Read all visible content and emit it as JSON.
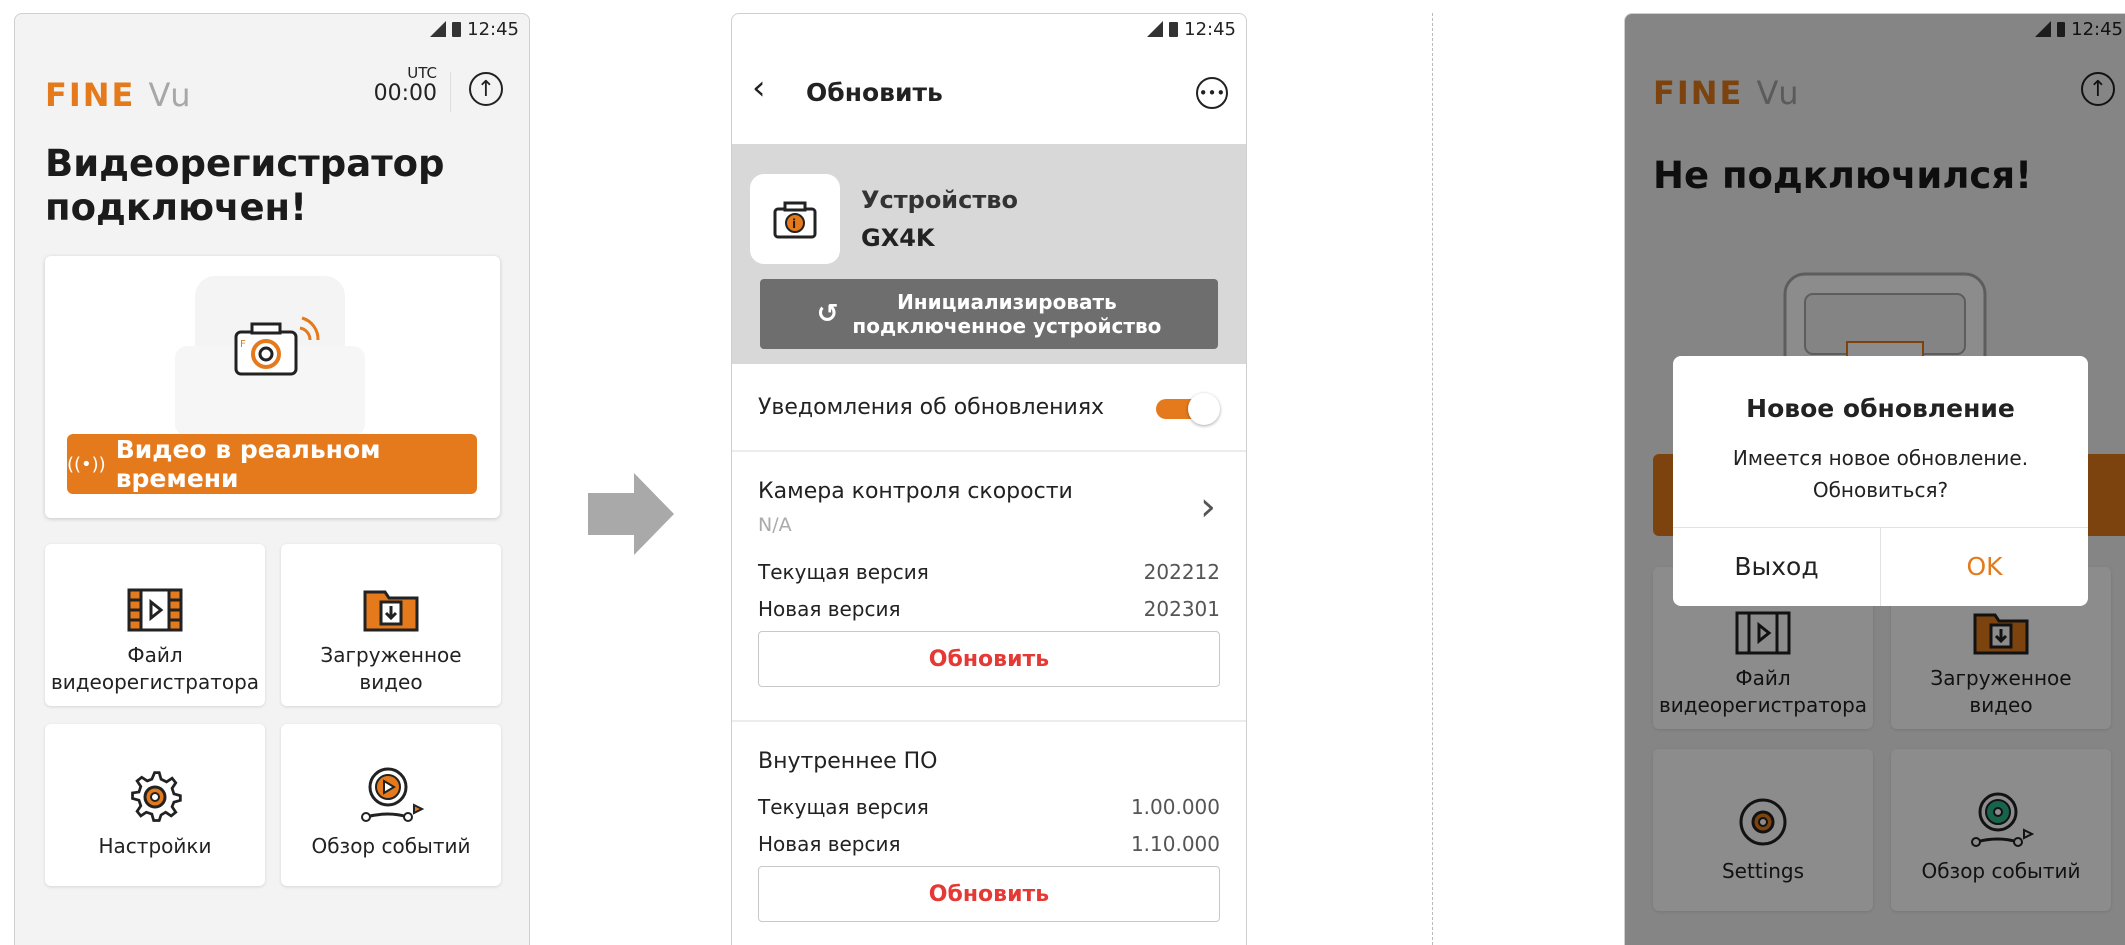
{
  "status_bar": {
    "time": "12:45"
  },
  "screen1": {
    "logo_fine": "FINE",
    "logo_vu": "Vu",
    "utc_label": "UTC",
    "utc_time": "00:00",
    "headline_line1": "Видеорегистратор",
    "headline_line2": "подключен!",
    "live_button": "Видео в реальном времени",
    "tiles": [
      {
        "label1": "Файл",
        "label2": "видеорегистратора"
      },
      {
        "label1": "Загруженное",
        "label2": "видео"
      },
      {
        "label1": "Настройки",
        "label2": ""
      },
      {
        "label1": "Обзор событий",
        "label2": ""
      }
    ]
  },
  "screen2": {
    "title": "Обновить",
    "device_label": "Устройство",
    "device_model": "GX4K",
    "init_button_line1": "Инициализировать",
    "init_button_line2": "подключенное устройство",
    "notifications_label": "Уведомления об обновлениях",
    "notifications_on": true,
    "speedcam": {
      "title": "Камера контроля скорости",
      "subtitle": "N/A",
      "current_label": "Текущая версия",
      "current_value": "202212",
      "new_label": "Новая версия",
      "new_value": "202301",
      "button": "Обновить"
    },
    "firmware": {
      "title": "Внутреннее ПО",
      "current_label": "Текущая версия",
      "current_value": "1.00.000",
      "new_label": "Новая версия",
      "new_value": "1.10.000",
      "button": "Обновить"
    }
  },
  "screen3": {
    "status_time": "12:45",
    "headline": "Не подключился!",
    "tiles": [
      {
        "label1": "Файл",
        "label2": "видеорегистратора"
      },
      {
        "label1": "Загруженное",
        "label2": "видео"
      },
      {
        "label1": "Settings",
        "label2": ""
      },
      {
        "label1": "Обзор событий",
        "label2": ""
      }
    ],
    "dialog": {
      "title": "Новое обновление",
      "message_line1": "Имеется новое обновление.",
      "message_line2": "Обновиться?",
      "cancel": "Выход",
      "ok": "OK"
    }
  },
  "colors": {
    "accent": "#e47a1c",
    "danger": "#e53935",
    "grey_button": "#6e6e6e"
  }
}
